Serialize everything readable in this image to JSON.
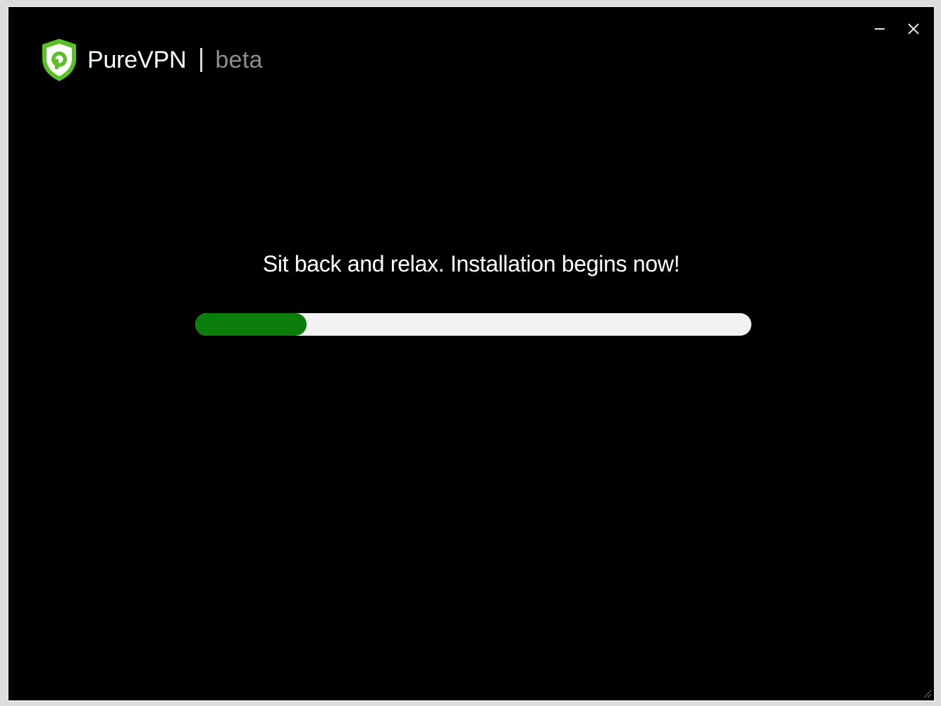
{
  "app": {
    "name": "PureVPN",
    "edition": "beta",
    "logo_icon": "shield-p-icon",
    "brand_color": "#5bbf2a"
  },
  "window_controls": {
    "minimize_icon": "minimize-icon",
    "close_icon": "close-icon"
  },
  "installer": {
    "headline": "Sit back and relax. Installation begins now!",
    "progress_fraction": 0.2,
    "progress_fill_color": "#0a7d0a",
    "progress_track_color": "#f2f2f2"
  }
}
